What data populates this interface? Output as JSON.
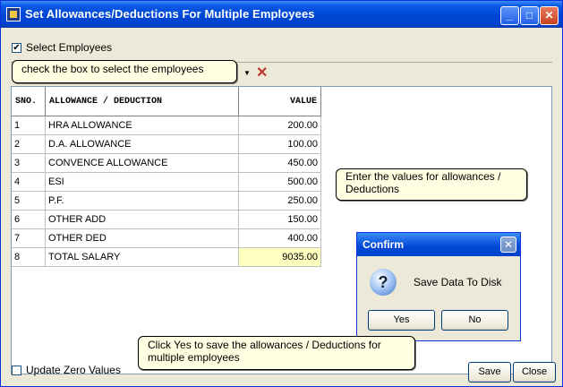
{
  "window": {
    "title": "Set Allowances/Deductions For Multiple Employees",
    "minimize": "_",
    "maximize": "□",
    "close": "✕"
  },
  "select_employees": {
    "label": "Select Employees",
    "checked": true
  },
  "grid": {
    "headers": {
      "sno": "SNO.",
      "name": "ALLOWANCE / DEDUCTION",
      "value": "VALUE"
    },
    "rows": [
      {
        "sno": "1",
        "name": "HRA ALLOWANCE",
        "value": "200.00"
      },
      {
        "sno": "2",
        "name": "D.A. ALLOWANCE",
        "value": "100.00"
      },
      {
        "sno": "3",
        "name": "CONVENCE ALLOWANCE",
        "value": "450.00"
      },
      {
        "sno": "4",
        "name": "ESI",
        "value": "500.00"
      },
      {
        "sno": "5",
        "name": "P.F.",
        "value": "250.00"
      },
      {
        "sno": "6",
        "name": "OTHER ADD",
        "value": "150.00"
      },
      {
        "sno": "7",
        "name": "OTHER DED",
        "value": "400.00"
      },
      {
        "sno": "8",
        "name": "TOTAL SALARY",
        "value": "9035.00"
      }
    ],
    "highlight_color": "#ffffc0"
  },
  "callouts": {
    "select": "check the box to select the employees",
    "values": "Enter the values for allowances / Deductions",
    "yes": "Click Yes to save the allowances / Deductions for multiple employees"
  },
  "confirm": {
    "title": "Confirm",
    "message": "Save Data To Disk",
    "yes": "Yes",
    "no": "No"
  },
  "footer": {
    "update_zero_label": "Update Zero Values",
    "save": "Save",
    "close": "Close"
  },
  "icons": {
    "app": "app-icon",
    "delete": "delete-x-icon",
    "question": "question-icon"
  }
}
